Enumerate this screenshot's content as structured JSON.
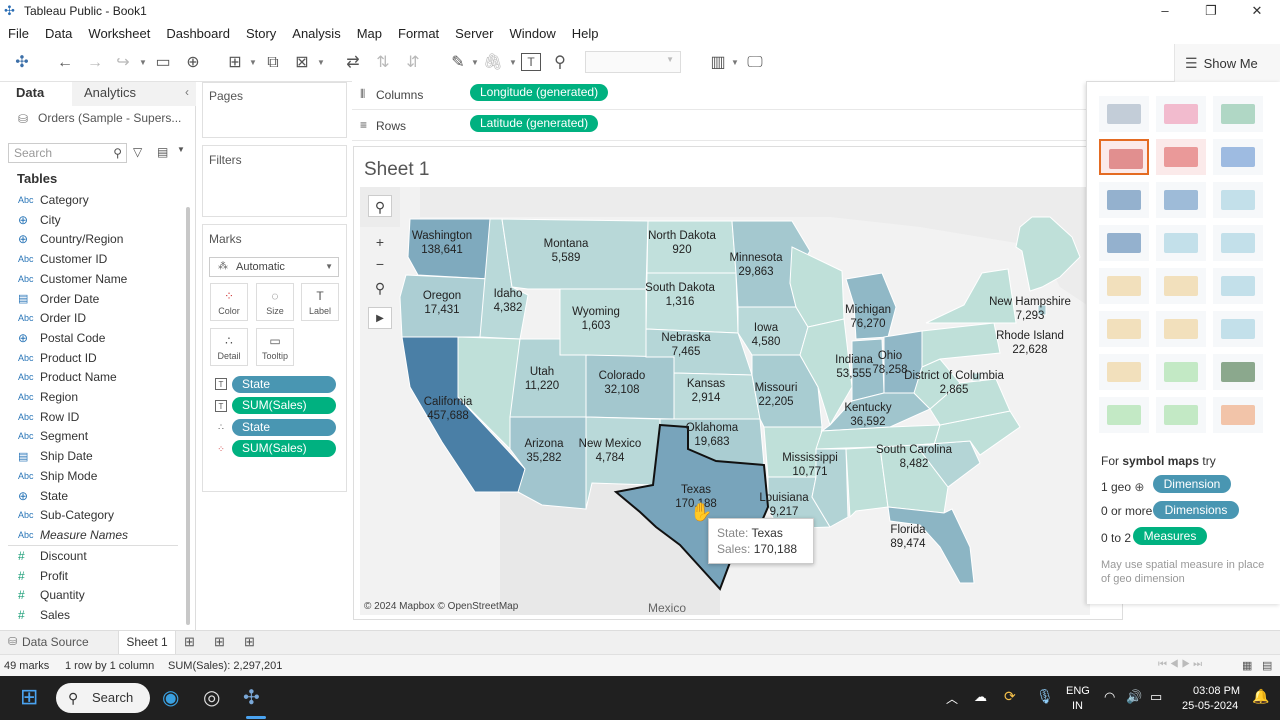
{
  "window": {
    "title": "Tableau Public - Book1",
    "controls": [
      "–",
      "❐",
      "✕"
    ]
  },
  "menu": [
    "File",
    "Data",
    "Worksheet",
    "Dashboard",
    "Story",
    "Analysis",
    "Map",
    "Format",
    "Server",
    "Window",
    "Help"
  ],
  "show_me_button": "Show Me",
  "data_pane": {
    "tabs": [
      "Data",
      "Analytics"
    ],
    "datasource": "Orders (Sample - Supers...",
    "search_placeholder": "Search",
    "tables_heading": "Tables",
    "dimensions": [
      {
        "name": "Category",
        "type": "Abc"
      },
      {
        "name": "City",
        "type": "geo"
      },
      {
        "name": "Country/Region",
        "type": "geo"
      },
      {
        "name": "Customer ID",
        "type": "Abc"
      },
      {
        "name": "Customer Name",
        "type": "Abc"
      },
      {
        "name": "Order Date",
        "type": "date"
      },
      {
        "name": "Order ID",
        "type": "Abc"
      },
      {
        "name": "Postal Code",
        "type": "geo"
      },
      {
        "name": "Product ID",
        "type": "Abc"
      },
      {
        "name": "Product Name",
        "type": "Abc"
      },
      {
        "name": "Region",
        "type": "Abc"
      },
      {
        "name": "Row ID",
        "type": "Abc"
      },
      {
        "name": "Segment",
        "type": "Abc"
      },
      {
        "name": "Ship Date",
        "type": "date"
      },
      {
        "name": "Ship Mode",
        "type": "Abc"
      },
      {
        "name": "State",
        "type": "geo"
      },
      {
        "name": "Sub-Category",
        "type": "Abc"
      },
      {
        "name": "Measure Names",
        "type": "Abc"
      }
    ],
    "measures": [
      {
        "name": "Discount",
        "type": "#"
      },
      {
        "name": "Profit",
        "type": "#"
      },
      {
        "name": "Quantity",
        "type": "#"
      },
      {
        "name": "Sales",
        "type": "#"
      }
    ]
  },
  "cards": {
    "pages": "Pages",
    "filters": "Filters",
    "marks": "Marks",
    "mark_type": "Automatic",
    "mark_buttons": [
      "Color",
      "Size",
      "Label",
      "Detail",
      "Tooltip"
    ],
    "mark_pills": [
      {
        "label": "State",
        "kind": "dim",
        "icon": "T"
      },
      {
        "label": "SUM(Sales)",
        "kind": "meas",
        "icon": "T"
      },
      {
        "label": "State",
        "kind": "dim",
        "icon": "∴"
      },
      {
        "label": "SUM(Sales)",
        "kind": "meas",
        "icon": "⁘"
      }
    ]
  },
  "shelves": {
    "columns_label": "Columns",
    "columns_pill": "Longitude (generated)",
    "rows_label": "Rows",
    "rows_pill": "Latitude (generated)"
  },
  "sheet": {
    "title": "Sheet 1",
    "attribution": "© 2024 Mapbox © OpenStreetMap",
    "mexico_label": "Mexico"
  },
  "chart_data": {
    "type": "map",
    "measure": "SUM(Sales)",
    "states": [
      {
        "name": "Washington",
        "value": 138641
      },
      {
        "name": "Oregon",
        "value": 17431
      },
      {
        "name": "California",
        "value": 457688
      },
      {
        "name": "Idaho",
        "value": 4382
      },
      {
        "name": "Montana",
        "value": 5589
      },
      {
        "name": "Wyoming",
        "value": 1603
      },
      {
        "name": "Utah",
        "value": 11220
      },
      {
        "name": "Colorado",
        "value": 32108
      },
      {
        "name": "Arizona",
        "value": 35282
      },
      {
        "name": "New Mexico",
        "value": 4784
      },
      {
        "name": "North Dakota",
        "value": 920
      },
      {
        "name": "South Dakota",
        "value": 1316
      },
      {
        "name": "Nebraska",
        "value": 7465
      },
      {
        "name": "Kansas",
        "value": 2914
      },
      {
        "name": "Oklahoma",
        "value": 19683
      },
      {
        "name": "Texas",
        "value": 170188
      },
      {
        "name": "Minnesota",
        "value": 29863
      },
      {
        "name": "Iowa",
        "value": 4580
      },
      {
        "name": "Missouri",
        "value": 22205
      },
      {
        "name": "Louisiana",
        "value": 9217
      },
      {
        "name": "Mississippi",
        "value": 10771
      },
      {
        "name": "Michigan",
        "value": 76270
      },
      {
        "name": "Indiana",
        "value": 53555
      },
      {
        "name": "Ohio",
        "value": 78258
      },
      {
        "name": "Kentucky",
        "value": 36592
      },
      {
        "name": "South Carolina",
        "value": 8482
      },
      {
        "name": "Florida",
        "value": 89474
      },
      {
        "name": "District of Columbia",
        "value": 2865
      },
      {
        "name": "New Hampshire",
        "value": 7293
      },
      {
        "name": "Rhode Island",
        "value": 22628
      }
    ]
  },
  "tooltip": {
    "state_key": "State:",
    "state_val": "Texas",
    "sales_key": "Sales:",
    "sales_val": "170,188"
  },
  "show_me": {
    "hint_prefix": "For ",
    "hint_bold": "symbol maps",
    "hint_suffix": " try",
    "rows": [
      {
        "req": "1 geo",
        "pill": "Dimension",
        "kind": "dim"
      },
      {
        "req": "0 or more",
        "pill": "Dimensions",
        "kind": "dim"
      },
      {
        "req": "0 to 2",
        "pill": "Measures",
        "kind": "meas"
      }
    ],
    "note": "May use spatial measure in place of geo dimension"
  },
  "sheet_tabs": {
    "data_source": "Data Source",
    "sheet": "Sheet 1"
  },
  "status": {
    "marks": "49 marks",
    "dims": "1 row by 1 column",
    "sum": "SUM(Sales): 2,297,201"
  },
  "taskbar": {
    "search": "Search",
    "lang1": "ENG",
    "lang2": "IN",
    "time": "03:08 PM",
    "date": "25-05-2024"
  },
  "colors": {
    "dim_pill": "#4996b2",
    "meas_pill": "#00b180",
    "map_low": "#c9e6e0",
    "map_high": "#4a7fa6",
    "selection": "#e46b22"
  }
}
